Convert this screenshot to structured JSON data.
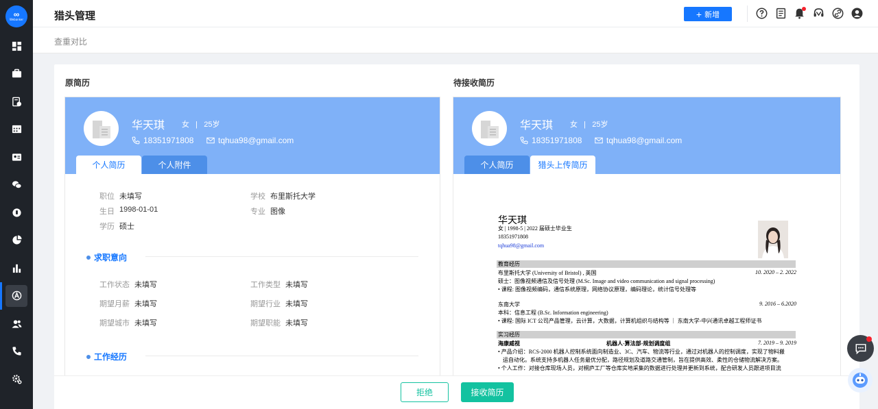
{
  "app": {
    "logo_text": "Webanker"
  },
  "header": {
    "title": "猎头管理",
    "add_label": "新增"
  },
  "breadcrumb": "查重对比",
  "colors": {
    "primary": "#1677ff",
    "accent": "#13c2a0",
    "header_blue": "#7fb1f8"
  },
  "left": {
    "section_title": "原简历",
    "candidate": {
      "name": "华天琪",
      "gender": "女",
      "sep": "|",
      "age": "25岁",
      "phone": "18351971808",
      "email": "tqhua98@gmail.com"
    },
    "tabs": [
      "个人简历",
      "个人附件"
    ],
    "basic": [
      {
        "label": "职位",
        "value": "未填写"
      },
      {
        "label": "学校",
        "value": "布里斯托大学"
      },
      {
        "label": "生日",
        "value": "1998-01-01"
      },
      {
        "label": "专业",
        "value": "图像"
      },
      {
        "label": "学历",
        "value": "硕士"
      }
    ],
    "intent_title": "求职意向",
    "intent": [
      {
        "label": "工作状态",
        "value": "未填写"
      },
      {
        "label": "工作类型",
        "value": "未填写"
      },
      {
        "label": "期望月薪",
        "value": "未填写"
      },
      {
        "label": "期望行业",
        "value": "未填写"
      },
      {
        "label": "期望城市",
        "value": "未填写"
      },
      {
        "label": "期望职能",
        "value": "未填写"
      }
    ],
    "work_title": "工作经历"
  },
  "right": {
    "section_title": "待接收简历",
    "candidate": {
      "name": "华天琪",
      "gender": "女",
      "sep": "|",
      "age": "25岁",
      "phone": "18351971808",
      "email": "tqhua98@gmail.com"
    },
    "tabs": [
      "个人简历",
      "猎头上传简历"
    ],
    "doc": {
      "name": "华天琪",
      "line1": "女 | 1998-5 | 2022 届硕士毕业生",
      "phone": "18351971808",
      "email": "tqhua98@gmail.com",
      "edu_header": "教育经历",
      "edu1_school": "布里斯托大学 (University of Bristol) , 英国",
      "edu1_date": "10. 2020 – 2. 2022",
      "edu1_major": "硕士：图像视频通信及信号处理 (M.Sc. Image and video communication and signal processing)",
      "edu1_course": "• 课程: 图像视频编码，通信系统原理，网络协议原理，编码理论，统计信号处理等",
      "edu2_school": "东南大学",
      "edu2_date": "9. 2016 – 6.2020",
      "edu2_major": "本科：信息工程 (B.Sc. Information engineering)",
      "edu2_course": "• 课程: 国际 ICT 公司产品管理，云计算，大数据，计算机组织与结构等 ｜ 东南大学-中兴通讯卓越工程师证书",
      "intern_header": "实习经历",
      "intern_company": "海康威视",
      "intern_dept": "机器人-算法部-规划调度组",
      "intern_date": "7. 2019 – 9. 2019",
      "intern_p1": "• 产品介绍：RCS-2000 机器人控制系统面向制造业、3C、汽车、物流等行业，通过对机器人的控制调度，实现了物料搬",
      "intern_p2": "运自动化。系统支持多机器人任务最优分配，路径规划及道路交通管制，旨在提供高效、柔性的仓储物流解决方案。",
      "intern_p3": "• 个人工作：对接仓库现场人员，对桐庐工厂等仓库实地采集的数据进行处理并更新到系统，配合研发人员跟进项目流"
    }
  },
  "footer": {
    "reject": "拒绝",
    "accept": "接收简历"
  }
}
